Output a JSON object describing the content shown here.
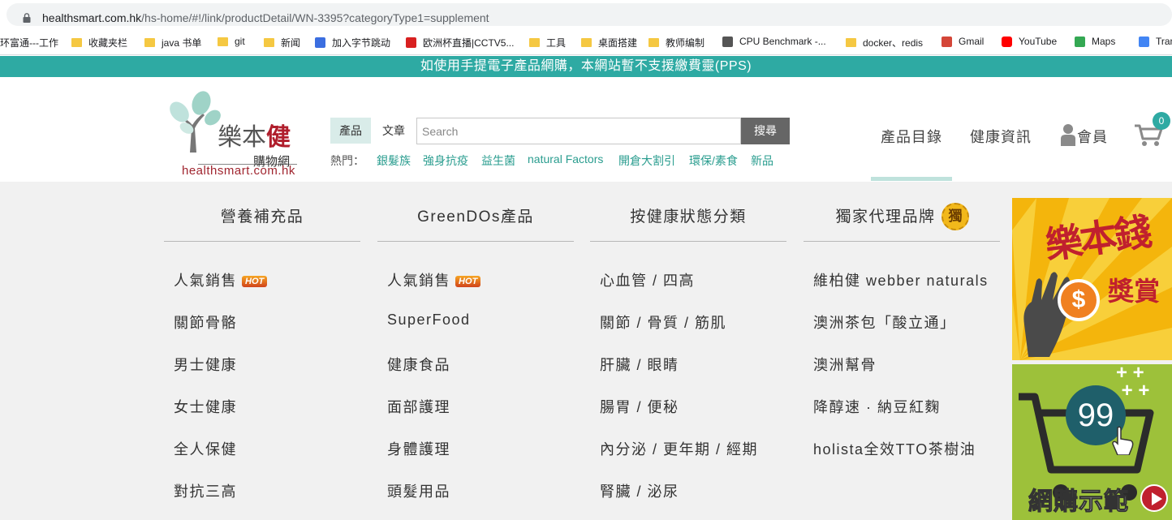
{
  "browser": {
    "url_host": "healthsmart.com.hk",
    "url_path": "/hs-home/#!/link/productDetail/WN-3395?categoryType1=supplement",
    "bookmarks": [
      {
        "label": "环富通---工作",
        "icon": "text"
      },
      {
        "label": "收藏夹栏",
        "icon": "folder"
      },
      {
        "label": "java 书单",
        "icon": "folder"
      },
      {
        "label": "git",
        "icon": "folder"
      },
      {
        "label": "新闻",
        "icon": "folder"
      },
      {
        "label": "加入字节跳动",
        "icon": "bar-chart-icon"
      },
      {
        "label": "欧洲杯直播|CCTV5...",
        "icon": "cctv5-icon"
      },
      {
        "label": "工具",
        "icon": "folder"
      },
      {
        "label": "桌面搭建",
        "icon": "folder"
      },
      {
        "label": "教师编制",
        "icon": "folder"
      },
      {
        "label": "CPU Benchmark -...",
        "icon": "chip-icon"
      },
      {
        "label": "docker、redis",
        "icon": "folder"
      },
      {
        "label": "Gmail",
        "icon": "gmail-icon"
      },
      {
        "label": "YouTube",
        "icon": "youtube-icon"
      },
      {
        "label": "Maps",
        "icon": "maps-icon"
      },
      {
        "label": "Tran",
        "icon": "translate-icon"
      }
    ]
  },
  "notice": "如使用手提電子產品網購，本網站暫不支援繳費靈(PPS)",
  "logo": {
    "name_main": "樂本",
    "name_accent": "健",
    "subtitle": "購物網",
    "url": "healthsmart.com.hk"
  },
  "search": {
    "tabs": [
      {
        "label": "產品",
        "active": true
      },
      {
        "label": "文章",
        "active": false
      }
    ],
    "placeholder": "Search",
    "value": "",
    "button": "搜尋",
    "hot_label": "熱門：",
    "hot_links": [
      "銀髮族",
      "強身抗疫",
      "益生菌",
      "natural Factors",
      "開倉大割引",
      "環保/素食",
      "新品"
    ]
  },
  "nav": {
    "items": [
      "產品目錄",
      "健康資訊",
      "會員"
    ],
    "cart_count": "0"
  },
  "menu": {
    "hot_badge": "HOT",
    "exclusive_badge": "獨",
    "columns": [
      {
        "title": "營養補充品",
        "items": [
          {
            "label": "人氣銷售",
            "hot": true
          },
          {
            "label": "關節骨骼"
          },
          {
            "label": "男士健康"
          },
          {
            "label": "女士健康"
          },
          {
            "label": "全人保健"
          },
          {
            "label": "對抗三高"
          }
        ]
      },
      {
        "title": "GreenDOs產品",
        "items": [
          {
            "label": "人氣銷售",
            "hot": true
          },
          {
            "label": "SuperFood"
          },
          {
            "label": "健康食品"
          },
          {
            "label": "面部護理"
          },
          {
            "label": "身體護理"
          },
          {
            "label": "頭髮用品"
          }
        ]
      },
      {
        "title": "按健康狀態分類",
        "items": [
          {
            "label": "心血管 / 四高"
          },
          {
            "label": "關節 / 骨質 / 筋肌"
          },
          {
            "label": "肝臟 / 眼睛"
          },
          {
            "label": "腸胃 / 便秘"
          },
          {
            "label": "內分泌 / 更年期 / 經期"
          },
          {
            "label": "腎臟 / 泌尿"
          }
        ]
      },
      {
        "title": "獨家代理品牌",
        "items": [
          {
            "label": "維柏健 webber naturals"
          },
          {
            "label": "澳洲茶包「酸立通」"
          },
          {
            "label": "澳洲幫骨"
          },
          {
            "label": "降醇速 · 納豆紅麴"
          },
          {
            "label": "holista全效TTO茶樹油"
          }
        ]
      }
    ]
  },
  "banners": {
    "rewards": {
      "line1": "樂本錢",
      "line2": "獎賞",
      "symbol": "$"
    },
    "demo": {
      "number": "99",
      "label": "網購示範"
    }
  },
  "colors": {
    "teal": "#2eaaa3",
    "teal_link": "#2a9d8f",
    "brand_red": "#b01e2c",
    "menu_bg": "#f1f1f1",
    "banner_yellow": "#f4b50c",
    "banner_green": "#9dc13a"
  }
}
